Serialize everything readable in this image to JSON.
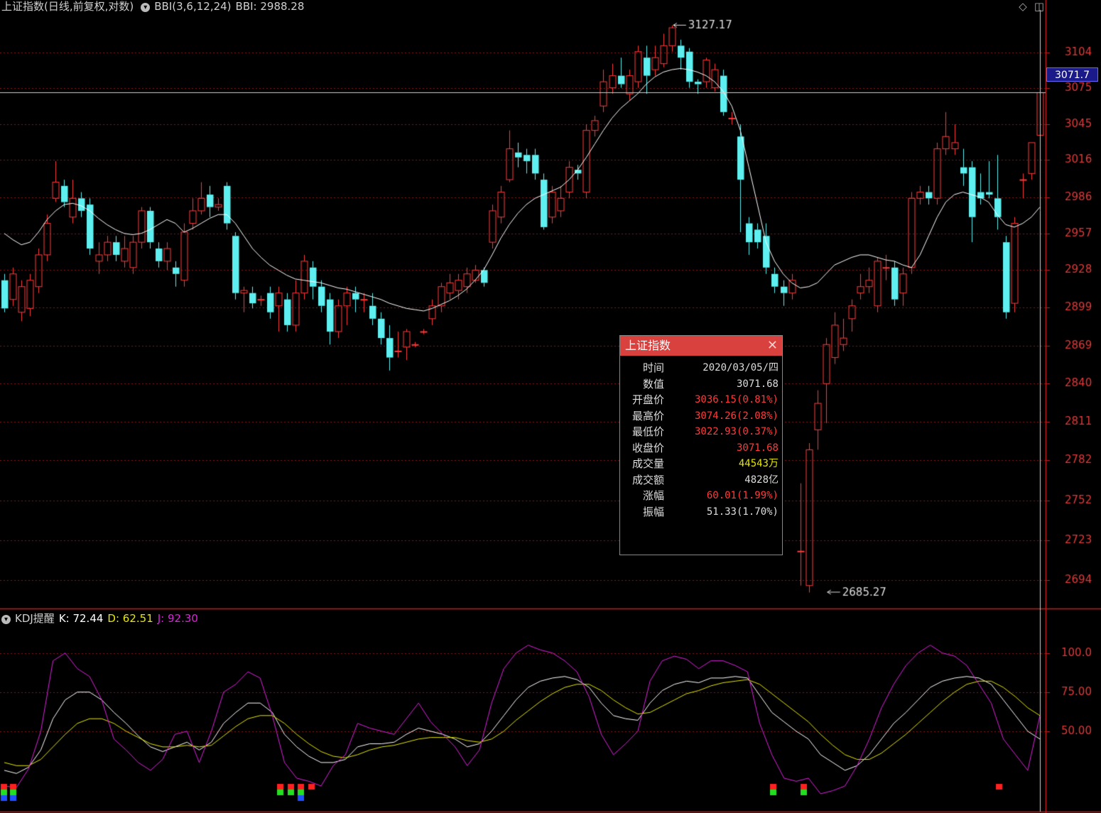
{
  "header": {
    "title": "上证指数(日线,前复权,对数)",
    "indicator": "BBI(3,6,12,24)",
    "indicator_value": "BBI: 2988.28"
  },
  "kdj_header": {
    "name": "KDJ提醒",
    "k": "K: 72.44",
    "d": "D: 62.51",
    "j": "J: 92.30"
  },
  "colors": {
    "up": "#ff3b3b",
    "down": "#5ef0f0",
    "bbi": "#ffffff",
    "k": "#ffffff",
    "d": "#e6e600",
    "j": "#e020e0",
    "grid": "#8a1414",
    "axis": "#c41e1e"
  },
  "current_price_label": "3071.7",
  "popup": {
    "title": "上证指数",
    "close": "✕",
    "rows": [
      {
        "label": "时间",
        "value": "2020/03/05/四",
        "color": "#dddddd"
      },
      {
        "label": "数值",
        "value": "3071.68",
        "color": "#dddddd"
      },
      {
        "label": "开盘价",
        "value": "3036.15(0.81%)",
        "color": "#ff3b3b"
      },
      {
        "label": "最高价",
        "value": "3074.26(2.08%)",
        "color": "#ff3b3b"
      },
      {
        "label": "最低价",
        "value": "3022.93(0.37%)",
        "color": "#ff3b3b"
      },
      {
        "label": "收盘价",
        "value": "3071.68",
        "color": "#ff3b3b"
      },
      {
        "label": "成交量",
        "value": "44543万",
        "color": "#e6e600"
      },
      {
        "label": "成交额",
        "value": "4828亿",
        "color": "#dddddd"
      },
      {
        "label": "涨幅",
        "value": "60.01(1.99%)",
        "color": "#ff3b3b"
      },
      {
        "label": "振幅",
        "value": "51.33(1.70%)",
        "color": "#dddddd"
      }
    ]
  },
  "chart_data": [
    {
      "type": "candlestick",
      "title": "上证指数(日线,前复权,对数)",
      "y_ticks": [
        3104,
        3075,
        3045,
        3016,
        2986,
        2957,
        2928,
        2899,
        2869,
        2840,
        2811,
        2782,
        2752,
        2723,
        2694
      ],
      "ylim": [
        2674,
        3140
      ],
      "annotations": [
        {
          "text": "3127.17",
          "value": 3127.17,
          "index": 78
        },
        {
          "text": "2685.27",
          "value": 2685.27,
          "index": 96
        }
      ],
      "candles": [
        [
          2920,
          2898,
          2925,
          2895
        ],
        [
          2905,
          2925,
          2930,
          2900
        ],
        [
          2895,
          2915,
          2920,
          2888
        ],
        [
          2898,
          2920,
          2925,
          2892
        ],
        [
          2915,
          2940,
          2945,
          2910
        ],
        [
          2940,
          2965,
          2972,
          2935
        ],
        [
          2985,
          2998,
          3015,
          2982
        ],
        [
          2995,
          2982,
          3000,
          2978
        ],
        [
          2970,
          2985,
          3000,
          2965
        ],
        [
          2985,
          2975,
          2990,
          2970
        ],
        [
          2980,
          2945,
          2985,
          2940
        ],
        [
          2935,
          2940,
          2950,
          2925
        ],
        [
          2940,
          2950,
          2955,
          2935
        ],
        [
          2950,
          2940,
          2955,
          2935
        ],
        [
          2935,
          2945,
          2955,
          2930
        ],
        [
          2930,
          2950,
          2955,
          2925
        ],
        [
          2950,
          2975,
          2978,
          2945
        ],
        [
          2975,
          2950,
          2978,
          2945
        ],
        [
          2945,
          2935,
          2950,
          2930
        ],
        [
          2935,
          2945,
          2950,
          2928
        ],
        [
          2930,
          2925,
          2935,
          2915
        ],
        [
          2920,
          2958,
          2965,
          2915
        ],
        [
          2965,
          2975,
          2985,
          2960
        ],
        [
          2975,
          2985,
          2998,
          2972
        ],
        [
          2988,
          2978,
          2995,
          2970
        ],
        [
          2978,
          2980,
          2985,
          2975
        ],
        [
          2995,
          2965,
          2998,
          2960
        ],
        [
          2955,
          2910,
          2958,
          2905
        ],
        [
          2910,
          2912,
          2915,
          2895
        ],
        [
          2910,
          2902,
          2915,
          2898
        ],
        [
          2905,
          2905,
          2908,
          2900
        ],
        [
          2910,
          2895,
          2915,
          2890
        ],
        [
          2900,
          2910,
          2915,
          2880
        ],
        [
          2905,
          2885,
          2910,
          2880
        ],
        [
          2885,
          2910,
          2920,
          2880
        ],
        [
          2910,
          2935,
          2940,
          2905
        ],
        [
          2930,
          2915,
          2935,
          2905
        ],
        [
          2915,
          2900,
          2920,
          2895
        ],
        [
          2905,
          2880,
          2910,
          2870
        ],
        [
          2880,
          2900,
          2905,
          2875
        ],
        [
          2900,
          2910,
          2915,
          2885
        ],
        [
          2910,
          2905,
          2915,
          2895
        ],
        [
          2905,
          2905,
          2910,
          2895
        ],
        [
          2900,
          2890,
          2910,
          2885
        ],
        [
          2890,
          2875,
          2895,
          2870
        ],
        [
          2875,
          2860,
          2885,
          2850
        ],
        [
          2865,
          2865,
          2880,
          2860
        ],
        [
          2868,
          2880,
          2882,
          2858
        ],
        [
          2870,
          2870,
          2872,
          2868
        ],
        [
          2880,
          2880,
          2882,
          2878
        ],
        [
          2890,
          2900,
          2905,
          2885
        ],
        [
          2900,
          2915,
          2918,
          2895
        ],
        [
          2910,
          2918,
          2925,
          2905
        ],
        [
          2912,
          2920,
          2925,
          2905
        ],
        [
          2915,
          2925,
          2930,
          2910
        ],
        [
          2920,
          2928,
          2932,
          2918
        ],
        [
          2928,
          2918,
          2930,
          2915
        ],
        [
          2950,
          2975,
          2980,
          2945
        ],
        [
          2970,
          2990,
          2995,
          2965
        ],
        [
          3000,
          3025,
          3040,
          2998
        ],
        [
          3022,
          3018,
          3030,
          3010
        ],
        [
          3020,
          3015,
          3025,
          3005
        ],
        [
          3020,
          3005,
          3025,
          3000
        ],
        [
          3000,
          2962,
          3005,
          2960
        ],
        [
          2970,
          2990,
          2995,
          2965
        ],
        [
          2975,
          2985,
          2995,
          2970
        ],
        [
          2990,
          3010,
          3015,
          2985
        ],
        [
          3008,
          3005,
          3012,
          3000
        ],
        [
          2990,
          3040,
          3045,
          2985
        ],
        [
          3040,
          3048,
          3052,
          3035
        ],
        [
          3060,
          3080,
          3090,
          3055
        ],
        [
          3075,
          3085,
          3095,
          3070
        ],
        [
          3085,
          3078,
          3100,
          3075
        ],
        [
          3070,
          3085,
          3090,
          3065
        ],
        [
          3080,
          3105,
          3110,
          3075
        ],
        [
          3100,
          3085,
          3110,
          3070
        ],
        [
          3090,
          3100,
          3110,
          3085
        ],
        [
          3095,
          3110,
          3120,
          3092
        ],
        [
          3110,
          3125,
          3127,
          3105
        ],
        [
          3110,
          3100,
          3115,
          3090
        ],
        [
          3105,
          3080,
          3108,
          3075
        ],
        [
          3080,
          3078,
          3082,
          3070
        ],
        [
          3080,
          3098,
          3100,
          3075
        ],
        [
          3075,
          3090,
          3095,
          3072
        ],
        [
          3085,
          3055,
          3090,
          3052
        ],
        [
          3050,
          3050,
          3055,
          3045
        ],
        [
          3035,
          3000,
          3045,
          2958
        ],
        [
          2965,
          2950,
          2970,
          2940
        ],
        [
          2960,
          2950,
          2965,
          2945
        ],
        [
          2955,
          2930,
          2965,
          2925
        ],
        [
          2925,
          2915,
          2930,
          2910
        ],
        [
          2915,
          2910,
          2920,
          2900
        ],
        [
          2910,
          2920,
          2925,
          2905
        ],
        [
          2715,
          2715,
          2765,
          2690
        ],
        [
          2690,
          2790,
          2795,
          2685
        ],
        [
          2805,
          2825,
          2835,
          2790
        ],
        [
          2840,
          2870,
          2875,
          2810
        ],
        [
          2860,
          2885,
          2895,
          2855
        ],
        [
          2870,
          2875,
          2890,
          2865
        ],
        [
          2890,
          2900,
          2905,
          2880
        ],
        [
          2910,
          2915,
          2925,
          2905
        ],
        [
          2915,
          2920,
          2930,
          2910
        ],
        [
          2900,
          2935,
          2938,
          2895
        ],
        [
          2930,
          2930,
          2940,
          2920
        ],
        [
          2930,
          2905,
          2935,
          2900
        ],
        [
          2910,
          2925,
          2930,
          2900
        ],
        [
          2930,
          2985,
          2990,
          2925
        ],
        [
          2985,
          2990,
          2995,
          2980
        ],
        [
          2990,
          2985,
          2995,
          2980
        ],
        [
          2985,
          3025,
          3030,
          2980
        ],
        [
          3025,
          3035,
          3055,
          3020
        ],
        [
          3025,
          3030,
          3045,
          3020
        ],
        [
          3010,
          3005,
          3025,
          2995
        ],
        [
          3010,
          2970,
          3015,
          2950
        ],
        [
          2990,
          2985,
          3005,
          2980
        ],
        [
          2990,
          2988,
          3015,
          2985
        ],
        [
          2985,
          2970,
          3020,
          2960
        ],
        [
          2950,
          2895,
          2955,
          2890
        ],
        [
          2902,
          2965,
          2970,
          2895
        ],
        [
          3000,
          3000,
          3005,
          2985
        ],
        [
          3005,
          3030,
          3030,
          3000
        ],
        [
          3036,
          3071,
          3074,
          3023
        ]
      ],
      "bbi": [
        2957,
        2952,
        2948,
        2950,
        2958,
        2968,
        2975,
        2980,
        2981,
        2979,
        2975,
        2969,
        2964,
        2960,
        2957,
        2956,
        2957,
        2960,
        2964,
        2968,
        2965,
        2958,
        2961,
        2965,
        2969,
        2972,
        2972,
        2965,
        2955,
        2945,
        2938,
        2932,
        2928,
        2924,
        2921,
        2920,
        2919,
        2918,
        2916,
        2914,
        2913,
        2911,
        2909,
        2907,
        2905,
        2902,
        2900,
        2898,
        2897,
        2896,
        2898,
        2901,
        2904,
        2908,
        2913,
        2920,
        2928,
        2940,
        2953,
        2964,
        2973,
        2980,
        2985,
        2988,
        2991,
        2994,
        3000,
        3008,
        3018,
        3029,
        3040,
        3050,
        3058,
        3064,
        3070,
        3078,
        3084,
        3088,
        3090,
        3091,
        3090,
        3088,
        3085,
        3080,
        3072,
        3060,
        3040,
        3010,
        2980,
        2950,
        2935,
        2925,
        2918,
        2914,
        2915,
        2918,
        2925,
        2932,
        2935,
        2938,
        2940,
        2940,
        2938,
        2936,
        2935,
        2932,
        2930,
        2940,
        2955,
        2970,
        2982,
        2988,
        2990,
        2988,
        2986,
        2982,
        2972,
        2964,
        2962,
        2965,
        2970,
        2978
      ]
    },
    {
      "type": "line",
      "title": "KDJ提醒",
      "y_ticks": [
        100.0,
        75.0,
        50.0
      ],
      "ylim": [
        0,
        118
      ],
      "series": [
        {
          "name": "K",
          "values": [
            25,
            23,
            27,
            38,
            58,
            70,
            75,
            75,
            70,
            62,
            55,
            47,
            40,
            37,
            40,
            43,
            38,
            43,
            55,
            62,
            68,
            68,
            62,
            48,
            40,
            34,
            30,
            30,
            32,
            40,
            42,
            42,
            43,
            48,
            52,
            50,
            48,
            45,
            40,
            42,
            50,
            60,
            70,
            78,
            82,
            84,
            85,
            83,
            78,
            68,
            60,
            58,
            57,
            68,
            76,
            80,
            82,
            81,
            84,
            84,
            85,
            84,
            73,
            62,
            56,
            50,
            45,
            35,
            30,
            25,
            28,
            35,
            45,
            55,
            62,
            70,
            78,
            82,
            84,
            85,
            84,
            80,
            70,
            60,
            50,
            45
          ]
        },
        {
          "name": "D",
          "values": [
            30,
            28,
            28,
            32,
            40,
            48,
            55,
            58,
            58,
            55,
            50,
            46,
            42,
            40,
            40,
            41,
            40,
            41,
            47,
            53,
            58,
            60,
            60,
            55,
            48,
            42,
            37,
            34,
            33,
            35,
            38,
            40,
            41,
            43,
            45,
            46,
            46,
            46,
            44,
            43,
            45,
            50,
            57,
            63,
            69,
            74,
            78,
            80,
            80,
            76,
            70,
            65,
            61,
            62,
            66,
            70,
            74,
            76,
            79,
            81,
            82,
            83,
            80,
            74,
            68,
            62,
            56,
            48,
            41,
            35,
            32,
            32,
            36,
            42,
            48,
            55,
            62,
            69,
            75,
            80,
            82,
            82,
            78,
            72,
            65,
            60
          ]
        },
        {
          "name": "J",
          "values": [
            15,
            14,
            26,
            50,
            95,
            100,
            90,
            85,
            70,
            45,
            38,
            30,
            25,
            32,
            48,
            50,
            30,
            50,
            75,
            80,
            88,
            84,
            60,
            30,
            20,
            18,
            15,
            28,
            35,
            55,
            52,
            50,
            48,
            58,
            68,
            56,
            48,
            40,
            28,
            38,
            68,
            90,
            100,
            105,
            102,
            100,
            95,
            88,
            72,
            48,
            35,
            42,
            50,
            82,
            95,
            98,
            96,
            90,
            95,
            95,
            92,
            88,
            55,
            35,
            20,
            18,
            20,
            10,
            12,
            15,
            28,
            45,
            65,
            80,
            92,
            100,
            105,
            100,
            98,
            92,
            80,
            68,
            45,
            35,
            25,
            60
          ]
        }
      ]
    }
  ]
}
